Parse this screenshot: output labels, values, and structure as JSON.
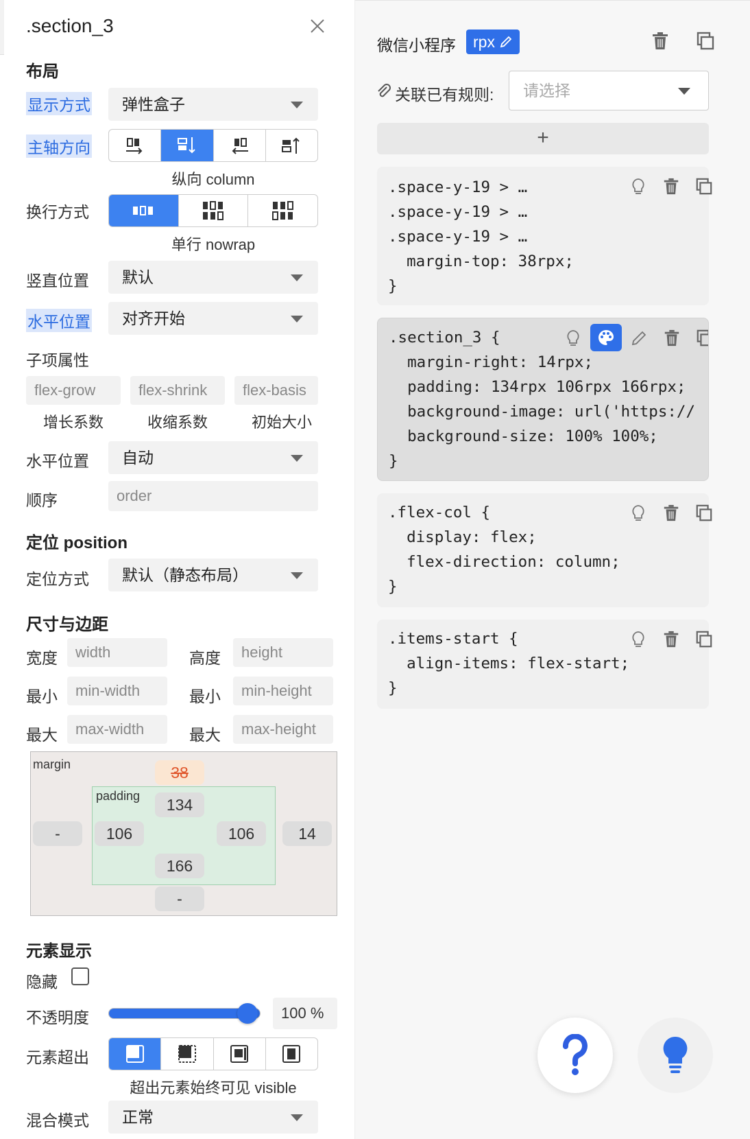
{
  "panel": {
    "title": ".section_3",
    "layout_heading": "布局",
    "display": {
      "label": "显示方式",
      "value": "弹性盒子"
    },
    "direction": {
      "label": "主轴方向",
      "caption": "纵向 column"
    },
    "wrap": {
      "label": "换行方式",
      "caption": "单行 nowrap"
    },
    "vertical": {
      "label": "竖直位置",
      "value": "默认"
    },
    "horizontal": {
      "label": "水平位置",
      "value": "对齐开始"
    },
    "child_heading": "子项属性",
    "flex_inputs": [
      {
        "placeholder": "flex-grow",
        "caption": "增长系数"
      },
      {
        "placeholder": "flex-shrink",
        "caption": "收缩系数"
      },
      {
        "placeholder": "flex-basis",
        "caption": "初始大小"
      }
    ],
    "self_align": {
      "label": "水平位置",
      "value": "自动"
    },
    "order": {
      "label": "顺序",
      "placeholder": "order"
    },
    "position_heading": "定位 position",
    "position": {
      "label": "定位方式",
      "value": "默认（静态布局）"
    },
    "size_heading": "尺寸与边距",
    "size_rows": [
      {
        "l1": "宽度",
        "p1": "width",
        "l2": "高度",
        "p2": "height"
      },
      {
        "l1": "最小",
        "p1": "min-width",
        "l2": "最小",
        "p2": "min-height"
      },
      {
        "l1": "最大",
        "p1": "max-width",
        "l2": "最大",
        "p2": "max-height"
      }
    ],
    "box": {
      "margin_label": "margin",
      "margin_top": "38",
      "margin_left": "-",
      "margin_right": "14",
      "margin_bottom": "-",
      "padding_label": "padding",
      "padding_top": "134",
      "padding_left": "106",
      "padding_right": "106",
      "padding_bottom": "166"
    },
    "display_heading": "元素显示",
    "hidden_label": "隐藏",
    "opacity": {
      "label": "不透明度",
      "value": "100",
      "unit": "%",
      "level": 1.0
    },
    "overflow": {
      "label": "元素超出",
      "caption": "超出元素始终可见 visible"
    },
    "blend": {
      "label": "混合模式",
      "value": "正常"
    }
  },
  "rules": {
    "platform": "微信小程序",
    "unit_badge": "rpx",
    "link_label": "关联已有规则:",
    "link_placeholder": "请选择",
    "add": "+",
    "cards": [
      {
        "code": ".space-y-19 > …\n.space-y-19 > …\n.space-y-19 > …\n  margin-top: 38rpx;\n}"
      },
      {
        "code": ".section_3 {\n  margin-right: 14rpx;\n  padding: 134rpx 106rpx 166rpx;\n  background-image: url('https://\n  background-size: 100% 100%;\n}"
      },
      {
        "code": ".flex-col {\n  display: flex;\n  flex-direction: column;\n}"
      },
      {
        "code": ".items-start {\n  align-items: flex-start;\n}"
      }
    ]
  },
  "colors": {
    "accent": "#3d82f0",
    "badge": "#2f6fe8",
    "strike": "#e0562b"
  },
  "icons": [
    "close-icon",
    "trash-icon",
    "copy-icon",
    "bulb-icon",
    "palette-icon",
    "pencil-icon",
    "help-icon",
    "paperclip-icon"
  ]
}
